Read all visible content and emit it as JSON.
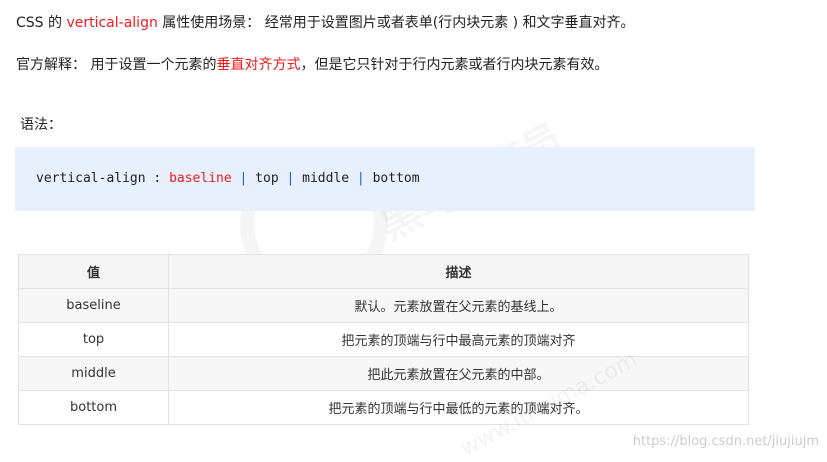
{
  "intro": {
    "prefix": "CSS 的 ",
    "keyword": "vertical-align",
    "suffix": " 属性使用场景： 经常用于设置图片或者表单(行内块元素 ) 和文字垂直对齐。"
  },
  "explain": {
    "prefix": "官方解释： 用于设置一个元素的",
    "highlight": "垂直对齐方式",
    "suffix": "，但是它只针对于行内元素或者行内块元素有效。"
  },
  "syntax_label": "语法：",
  "code": {
    "property": "vertical-align : ",
    "values": [
      "baseline",
      "top",
      "middle",
      "bottom"
    ],
    "separator": " | "
  },
  "table": {
    "headers": [
      "值",
      "描述"
    ],
    "rows": [
      {
        "value": "baseline",
        "desc": "默认。元素放置在父元素的基线上。"
      },
      {
        "value": "top",
        "desc": "把元素的顶端与行中最高元素的顶端对齐"
      },
      {
        "value": "middle",
        "desc": "把此元素放置在父元素的中部。"
      },
      {
        "value": "bottom",
        "desc": "把元素的顶端与行中最低的元素的顶端对齐。"
      }
    ]
  },
  "watermark": {
    "brand": "黑马程序员",
    "site": "www.itheima.com",
    "url": "https://blog.csdn.net/jiujiujm"
  },
  "colors": {
    "highlight": "#f01a1a",
    "code_bg": "#e8f0fd",
    "pipe": "#1a60d0"
  }
}
